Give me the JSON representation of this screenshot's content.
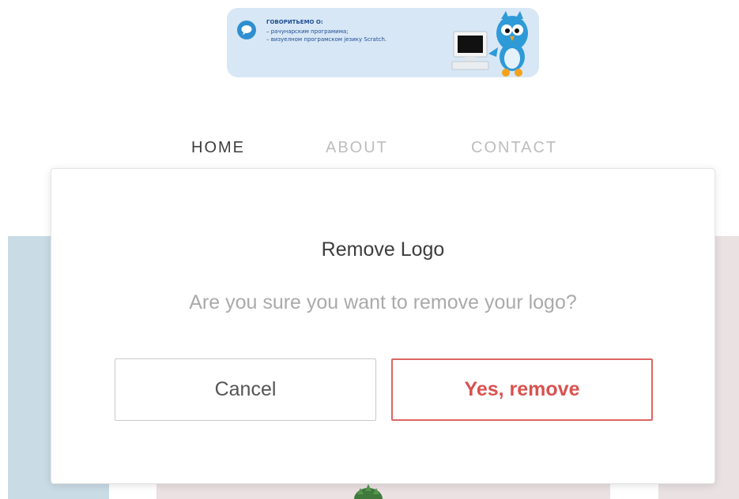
{
  "banner": {
    "heading": "ГОВОРИТЬЕМО О:",
    "lines": [
      "–  рачунарским програмима;",
      "–  визуелном програмском језику Scratch."
    ]
  },
  "nav": {
    "items": [
      {
        "label": "HOME",
        "active": true
      },
      {
        "label": "ABOUT",
        "active": false
      },
      {
        "label": "CONTACT",
        "active": false
      }
    ]
  },
  "modal": {
    "title": "Remove Logo",
    "message": "Are you sure you want to remove your logo?",
    "cancel_label": "Cancel",
    "confirm_label": "Yes, remove"
  },
  "colors": {
    "accent_danger": "#dd6562",
    "nav_active": "#3d3d3d",
    "nav_inactive": "#bdbdbd",
    "banner_bg": "#d7e7f5"
  },
  "icons": {
    "banner_badge": "speech-bubble-icon",
    "banner_computer": "computer-icon",
    "banner_mascot": "owl-mascot-icon"
  }
}
